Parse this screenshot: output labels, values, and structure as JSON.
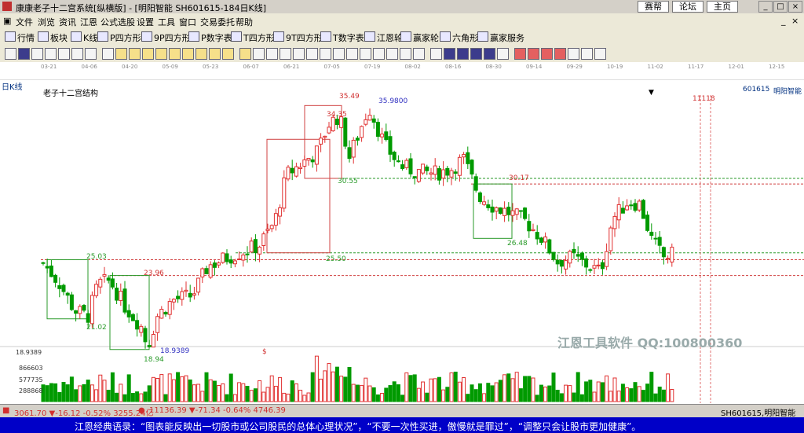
{
  "window": {
    "title": "康康老子十二宫系统[纵横版] - [明阳智能  SH601615-184日K线]",
    "links": [
      "赛帮",
      "论坛",
      "主页"
    ]
  },
  "menu": [
    "文件",
    "浏览",
    "资讯",
    "江恩",
    "公式选股",
    "设置",
    "工具",
    "窗口",
    "交易委托",
    "帮助"
  ],
  "toolbar1": [
    "行情",
    "板块",
    "K线",
    "P四方形",
    "9P四方形",
    "P数字表",
    "T四方形",
    "9T四方形",
    "T数字表",
    "江恩轮",
    "赢家轮",
    "六角形",
    "赢家服务"
  ],
  "date_labels": [
    "03-21",
    "04-06",
    "04-20",
    "05-09",
    "05-23",
    "06-07",
    "06-21",
    "07-05",
    "07-19",
    "08-02",
    "08-16",
    "08-30",
    "09-14",
    "09-29",
    "10-19",
    "11-02",
    "11-17",
    "12-01",
    "12-15"
  ],
  "chart": {
    "period_label": "日K线",
    "structure_label": "老子十二宫结构",
    "stock_code": "601615",
    "stock_name": "明阳智能",
    "top_right_mark": "11118",
    "price_labels": [
      "35.49",
      "35.9800",
      "34.35",
      "30.55",
      "30.17",
      "26.48",
      "25.50",
      "25.03",
      "23.96",
      "21.02",
      "18.94",
      "18.9389"
    ],
    "volume_axis": [
      "18.9389",
      "866603",
      "577735",
      "288868"
    ],
    "volume_mark": "$"
  },
  "watermark": {
    "text": "江恩工具软件  QQ:100800360"
  },
  "status": {
    "index1": "3061.70 ▼-16.12 -0.52% 3255.24亿",
    "index2": "11136.39 ▼-71.34 -0.64% 4746.39",
    "right": "SH601615,明阳智能"
  },
  "quote": "江恩经典语录：“图表能反映出一切股市或公司股民的总体心理状况”，“不要一次性买进，傲慢就是罪过”，“调整只会让股市更加健康”。",
  "colors": {
    "up": "#e03030",
    "down": "#009a00",
    "box_red": "#d04040",
    "box_green": "#2a9a2a",
    "quote_bg": "#0000c8"
  }
}
